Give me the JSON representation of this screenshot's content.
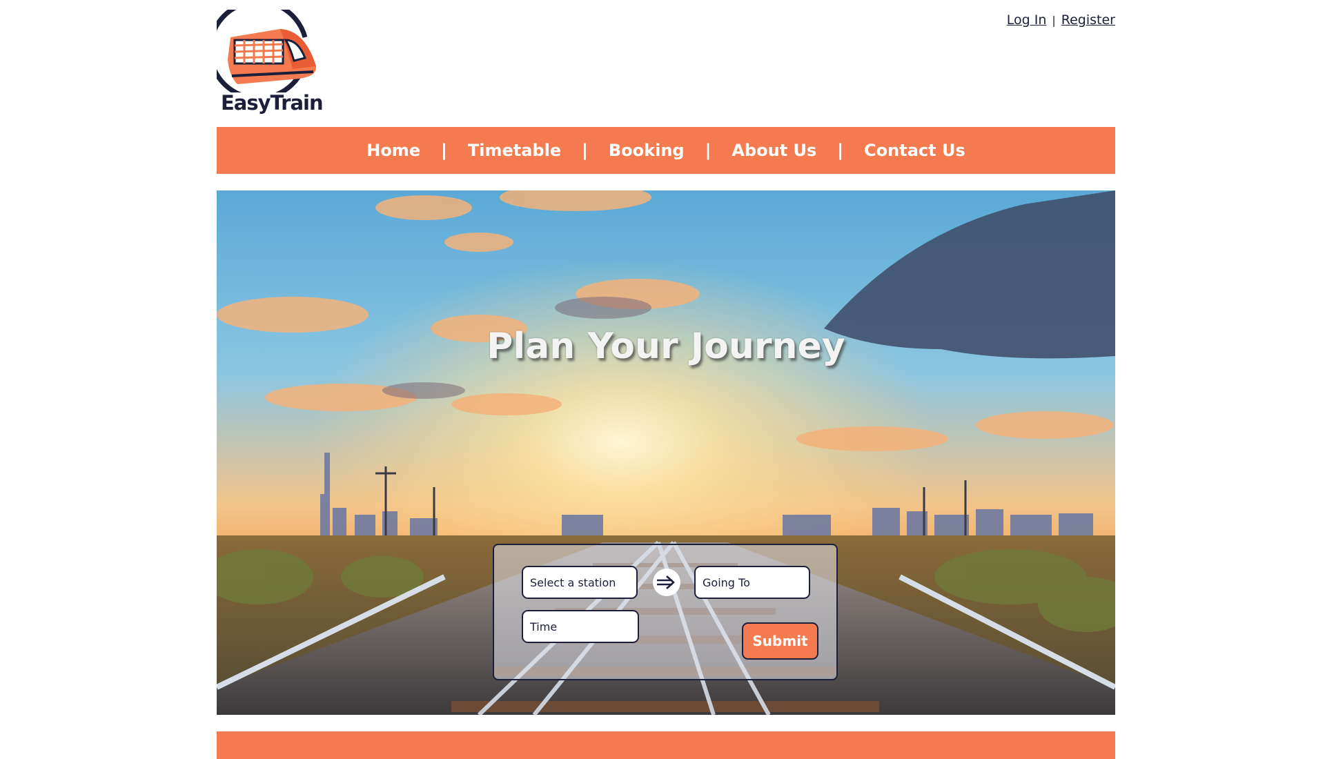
{
  "brand": {
    "name": "EasyTrain",
    "logo_icon": "train-logo-icon"
  },
  "auth": {
    "login_label": "Log In",
    "separator": "|",
    "register_label": "Register"
  },
  "nav": {
    "separator": "|",
    "items": [
      {
        "label": "Home"
      },
      {
        "label": "Timetable"
      },
      {
        "label": "Booking"
      },
      {
        "label": "About Us"
      },
      {
        "label": "Contact Us"
      }
    ]
  },
  "hero": {
    "title": "Plan Your Journey",
    "background": "sunset-railway-tracks-city-skyline"
  },
  "search": {
    "from_placeholder": "Select a station",
    "to_placeholder": "Going To",
    "time_placeholder": "Time",
    "swap_icon": "double-arrow-right-icon",
    "submit_label": "Submit"
  },
  "colors": {
    "accent": "#f47b50",
    "dark": "#1b1f3a",
    "background": "#ffffff"
  }
}
